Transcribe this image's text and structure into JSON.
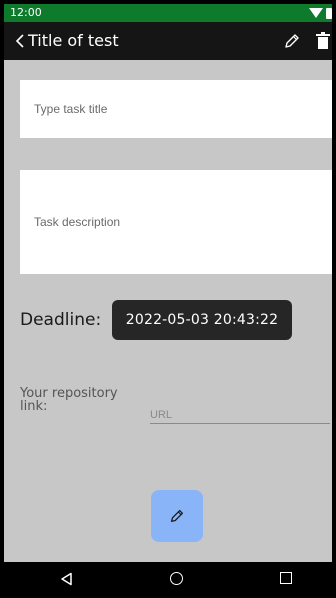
{
  "status_bar": {
    "time": "12:00"
  },
  "app_bar": {
    "title": "Title of test",
    "back_icon": "chevron-left-icon",
    "edit_icon": "pencil-icon",
    "delete_icon": "trash-icon"
  },
  "form": {
    "title_placeholder": "Type task title",
    "title_value": "",
    "description_placeholder": "Task description",
    "description_value": "",
    "deadline_label": "Deadline:",
    "deadline_value": "2022-05-03 20:43:22",
    "repo_label": "Your repository link:",
    "repo_placeholder": "URL",
    "repo_value": ""
  },
  "fab": {
    "icon": "pencil-icon",
    "color": "#8ab4f8"
  },
  "colors": {
    "status_bar": "#0e7a2c",
    "app_bar": "#151515",
    "background": "#c7c7c7",
    "chip": "#262626"
  }
}
